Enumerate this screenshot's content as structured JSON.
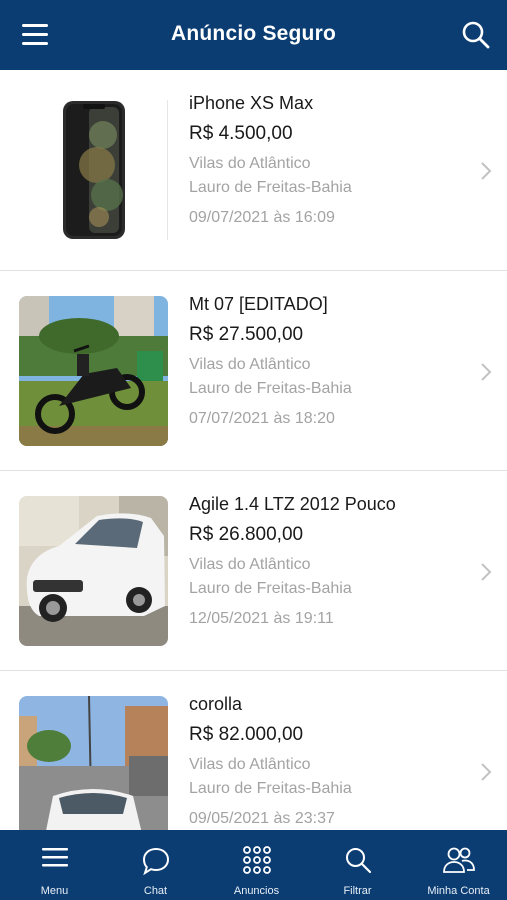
{
  "header": {
    "title": "Anúncio Seguro"
  },
  "listings": [
    {
      "title": "iPhone XS Max",
      "price": "R$ 4.500,00",
      "neighborhood": "Vilas do Atlântico",
      "city": "Lauro de Freitas-Bahia",
      "date": "09/07/2021 às 16:09"
    },
    {
      "title": "Mt 07 [EDITADO]",
      "price": "R$ 27.500,00",
      "neighborhood": "Vilas do Atlântico",
      "city": "Lauro de Freitas-Bahia",
      "date": "07/07/2021 às 18:20"
    },
    {
      "title": "Agile 1.4 LTZ 2012 Pouco",
      "price": "R$ 26.800,00",
      "neighborhood": "Vilas do Atlântico",
      "city": "Lauro de Freitas-Bahia",
      "date": "12/05/2021 às 19:11"
    },
    {
      "title": "corolla",
      "price": "R$ 82.000,00",
      "neighborhood": "Vilas do Atlântico",
      "city": "Lauro de Freitas-Bahia",
      "date": "09/05/2021 às 23:37"
    }
  ],
  "tabs": [
    {
      "label": "Menu",
      "icon": "hamburger-icon"
    },
    {
      "label": "Chat",
      "icon": "chat-bubble-icon"
    },
    {
      "label": "Anuncios",
      "icon": "grid-dots-icon"
    },
    {
      "label": "Filtrar",
      "icon": "search-icon"
    },
    {
      "label": "Minha Conta",
      "icon": "users-icon"
    }
  ],
  "colors": {
    "brand": "#0b3d73",
    "secondary_text": "#a3a3a3"
  }
}
